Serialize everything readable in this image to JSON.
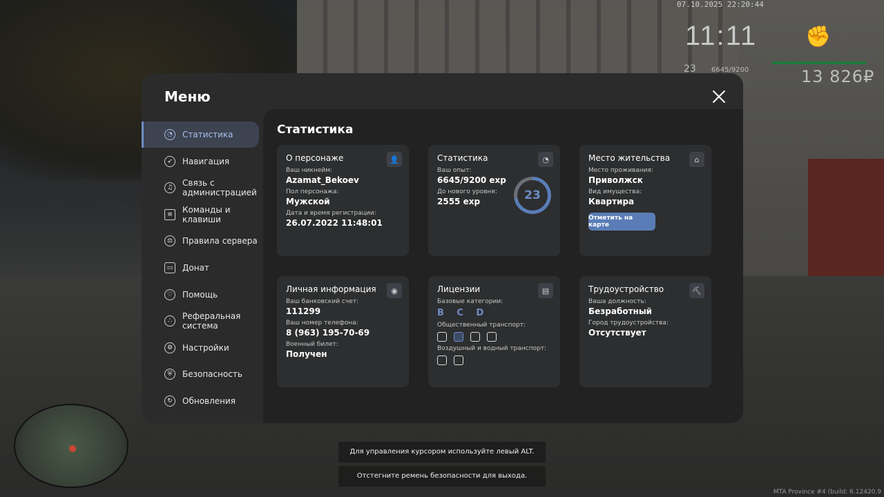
{
  "hud": {
    "datetime": "07.10.2025 22:20:44",
    "time": "11:11",
    "level": "23",
    "exp": "6645/9200",
    "money": "13 826₽"
  },
  "menu": {
    "title": "Меню",
    "sidebar": [
      {
        "label": "Статистика",
        "icon": "chart-pie-icon",
        "active": true
      },
      {
        "label": "Навигация",
        "icon": "compass-icon"
      },
      {
        "label": "Связь с администрацией",
        "icon": "headset-icon"
      },
      {
        "label": "Команды и клавиши",
        "icon": "document-icon"
      },
      {
        "label": "Правила сервера",
        "icon": "scales-icon"
      },
      {
        "label": "Донат",
        "icon": "wallet-icon"
      },
      {
        "label": "Помощь",
        "icon": "heart-hand-icon"
      },
      {
        "label": "Реферальная система",
        "icon": "network-icon"
      },
      {
        "label": "Настройки",
        "icon": "gear-icon"
      },
      {
        "label": "Безопасность",
        "icon": "shield-icon"
      },
      {
        "label": "Обновления",
        "icon": "refresh-icon"
      }
    ],
    "section_title": "Статистика",
    "cards": {
      "character": {
        "title": "О персонаже",
        "icon": "user-icon",
        "nick_label": "Ваш никнейм:",
        "nick": "Azamat_Bekoev",
        "gender_label": "Пол персонажа:",
        "gender": "Мужской",
        "reg_label": "Дата и время регистрации:",
        "reg": "26.07.2022 11:48:01"
      },
      "stats": {
        "title": "Статистика",
        "icon": "chart-pie-icon",
        "exp_label": "Ваш опыт:",
        "exp": "6645/9200 exp",
        "next_label": "До нового уровня:",
        "next": "2555 exp",
        "level": "23",
        "progress": 0.72
      },
      "residence": {
        "title": "Место жительства",
        "icon": "home-icon",
        "place_label": "Место проживания:",
        "place": "Приволжск",
        "type_label": "Вид имущества:",
        "type": "Квартира",
        "button": "Отметить на карте"
      },
      "personal": {
        "title": "Личная информация",
        "icon": "user-circle-icon",
        "bank_label": "Ваш банковский счет:",
        "bank": "111299",
        "phone_label": "Ваш номер телефона:",
        "phone": "8 (963) 195-70-69",
        "military_label": "Военный билет:",
        "military": "Получен"
      },
      "licenses": {
        "title": "Лицензии",
        "icon": "id-card-icon",
        "basic_label": "Базовые категории:",
        "basic": "B C D",
        "public_label": "Общественный транспорт:",
        "air_label": "Воздушный и водный транспорт:"
      },
      "job": {
        "title": "Трудоустройство",
        "icon": "pickaxe-icon",
        "position_label": "Ваша должность:",
        "position": "Безработный",
        "city_label": "Город трудоустройства:",
        "city": "Отсутствует"
      }
    }
  },
  "hints": {
    "cursor": "Для управления курсором используйте левый ALT.",
    "exit": "Отстегните ремень безопасности для выхода."
  },
  "build": "MTA Province #4 (build: 6.12420.9"
}
